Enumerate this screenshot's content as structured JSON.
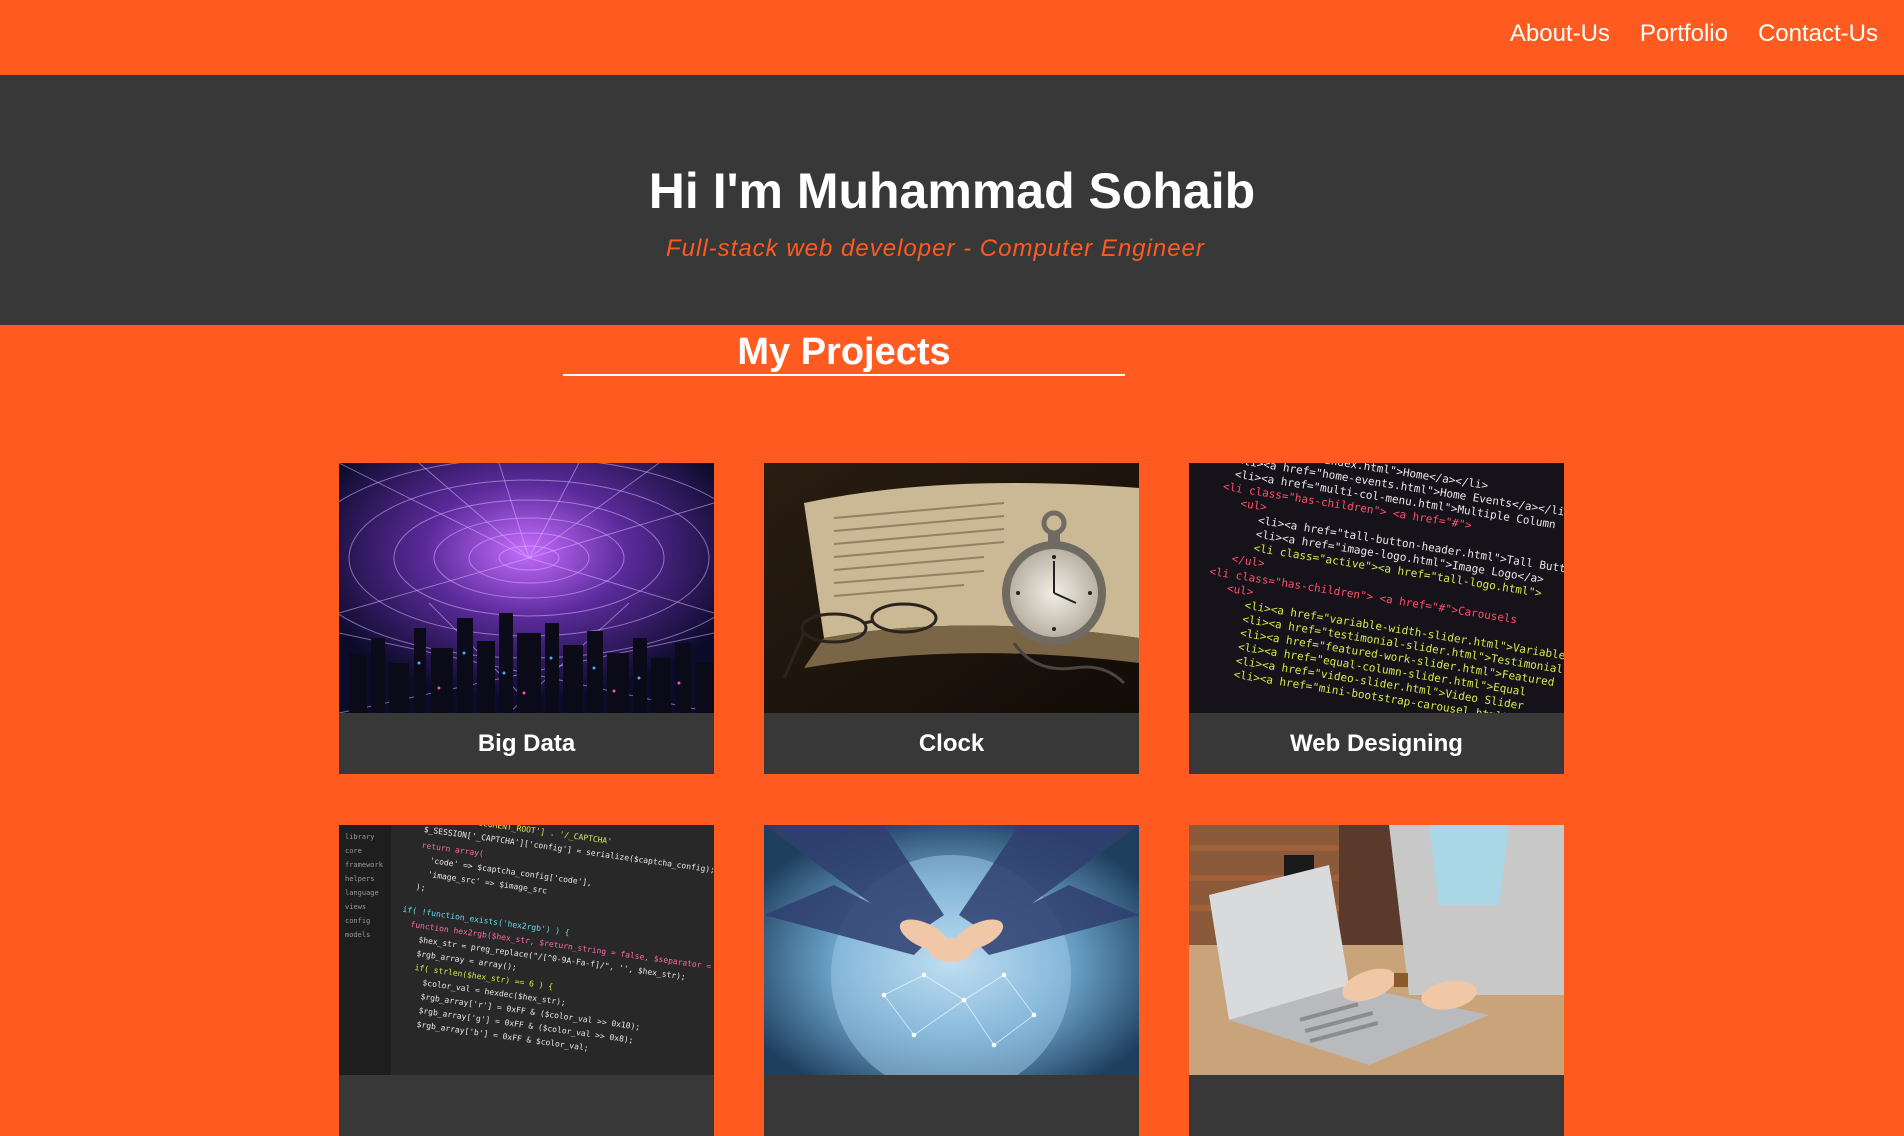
{
  "nav": {
    "items": [
      "About-Us",
      "Portfolio",
      "Contact-Us"
    ]
  },
  "hero": {
    "title": "Hi I'm Muhammad Sohaib",
    "subtitle": "Full-stack web developer - Computer Engineer"
  },
  "projects": {
    "heading": "My Projects",
    "cards": [
      {
        "caption": "Big Data"
      },
      {
        "caption": "Clock"
      },
      {
        "caption": "Web Designing"
      },
      {
        "caption": ""
      },
      {
        "caption": ""
      },
      {
        "caption": ""
      }
    ]
  },
  "colors": {
    "accent": "#ff5a1f",
    "dark": "#383838",
    "text": "#ffffff"
  }
}
